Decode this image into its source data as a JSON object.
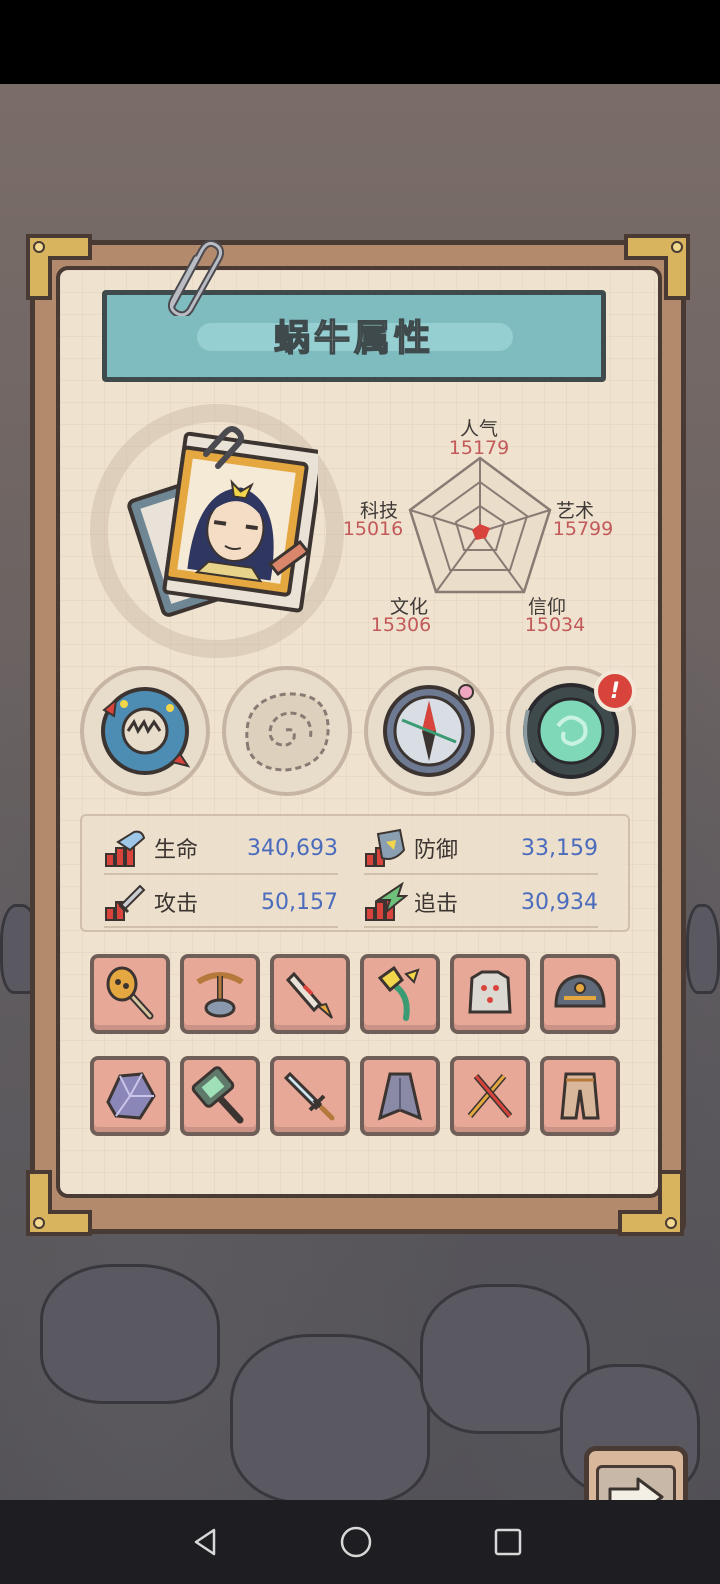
{
  "title": "蜗牛属性",
  "radar": {
    "top": {
      "label": "人气",
      "value": "15179"
    },
    "upper_left": {
      "label": "科技",
      "value": "15016"
    },
    "upper_right": {
      "label": "艺术",
      "value": "15799"
    },
    "lower_left": {
      "label": "文化",
      "value": "15306"
    },
    "lower_right": {
      "label": "信仰",
      "value": "15034"
    }
  },
  "badge": "!",
  "stats": {
    "hp": {
      "label": "生命",
      "value": "340,693"
    },
    "defense": {
      "label": "防御",
      "value": "33,159"
    },
    "attack": {
      "label": "攻击",
      "value": "50,157"
    },
    "pursuit": {
      "label": "追击",
      "value": "30,934"
    }
  },
  "icons": {
    "relic_slots": [
      "sea-creature-icon",
      "fossil-shell-icon",
      "compass-icon",
      "portal-ring-icon"
    ],
    "equipment": [
      "mace-icon",
      "crossbow-icon",
      "rocket-icon",
      "staff-icon",
      "armor-icon",
      "helmet-icon",
      "crystal-icon",
      "hammer-icon",
      "sword-icon",
      "cloak-icon",
      "dual-blade-icon",
      "pants-icon"
    ]
  },
  "colors": {
    "stat_value": "#4b6bbd",
    "radar_value": "#c25a5a",
    "banner": "#7fbcc0",
    "equip_slot": "#e7a898"
  }
}
